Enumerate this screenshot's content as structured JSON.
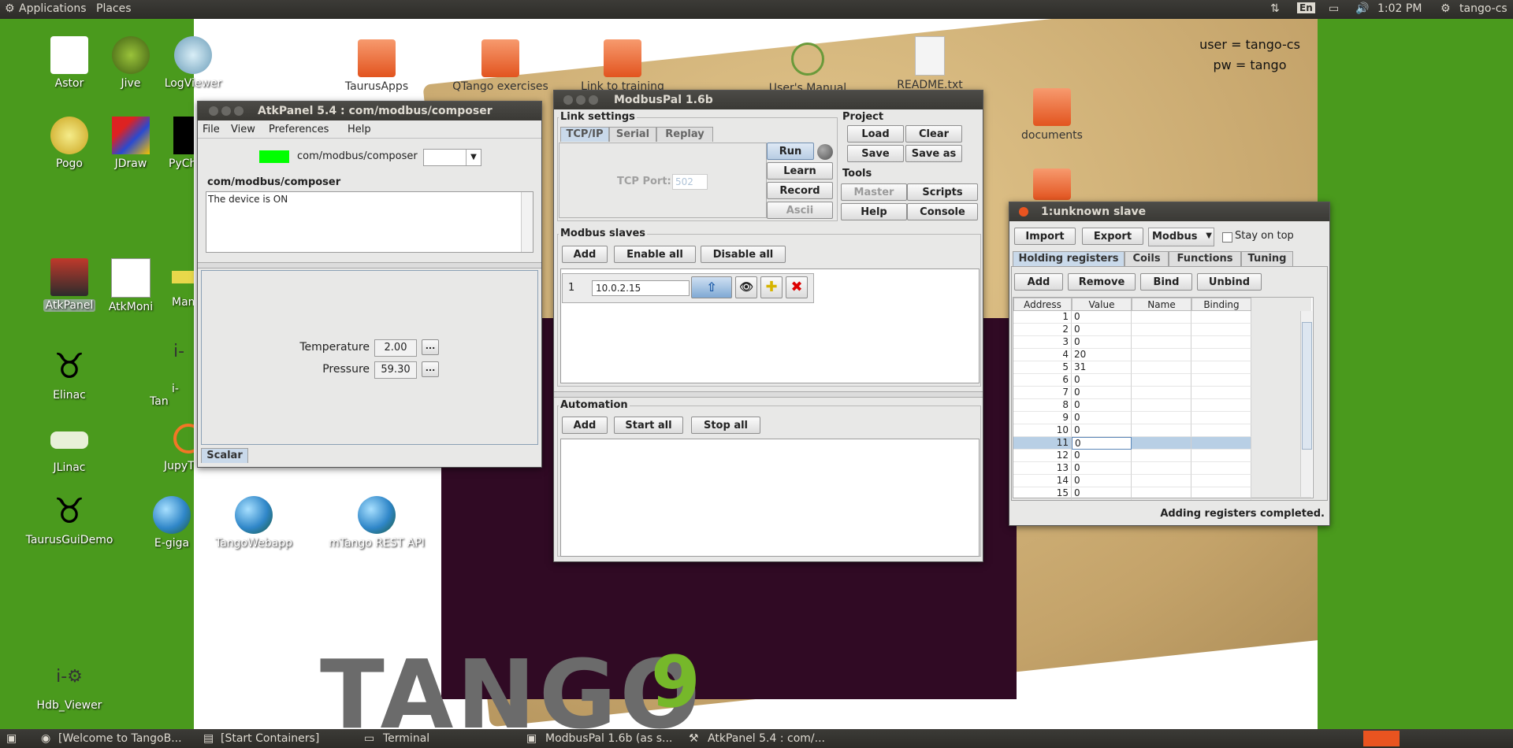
{
  "top_panel": {
    "applications": "Applications",
    "places": "Places",
    "lang": "En",
    "time": "1:02 PM",
    "user": "tango-cs"
  },
  "notes": {
    "user_line": "user = tango-cs",
    "pw_line": "pw = tango"
  },
  "desktop_icons": [
    {
      "label": "Astor"
    },
    {
      "label": "Jive"
    },
    {
      "label": "LogViewer"
    },
    {
      "label": "Pogo"
    },
    {
      "label": "JDraw"
    },
    {
      "label": "PyCh"
    },
    {
      "label": "AtkPanel"
    },
    {
      "label": "AtkMoni"
    },
    {
      "label": "Mam"
    },
    {
      "label": "Elinac"
    },
    {
      "label": "i-Tan"
    },
    {
      "label": "JLinac"
    },
    {
      "label": "JupyT"
    },
    {
      "label": "TaurusGuiDemo"
    },
    {
      "label": "E-giga"
    },
    {
      "label": "TangoWebapp"
    },
    {
      "label": "mTango REST API"
    },
    {
      "label": "Hdb_Viewer"
    },
    {
      "label": "TaurusApps"
    },
    {
      "label": "QTango exercises"
    },
    {
      "label": "Link to training"
    },
    {
      "label": "User's Manual"
    },
    {
      "label": "README.txt"
    },
    {
      "label": "documents"
    }
  ],
  "wallpaper": {
    "logo_text": "TANGO",
    "logo_suffix": "9"
  },
  "atkpanel": {
    "title": "AtkPanel  5.4  : com/modbus/composer",
    "menu": [
      "File",
      "View",
      "Preferences",
      "Help"
    ],
    "device_name": "com/modbus/composer",
    "status_group": "com/modbus/composer",
    "status_text": "The device is ON",
    "state_color": "#00ff00",
    "attrs": [
      {
        "label": "Temperature",
        "value": "2.00",
        "more": "..."
      },
      {
        "label": "Pressure",
        "value": "59.30",
        "more": "..."
      }
    ],
    "tab": "Scalar"
  },
  "modbuspal": {
    "title": "ModbusPal 1.6b",
    "link_settings": "Link settings",
    "link_tabs": [
      "TCP/IP",
      "Serial",
      "Replay"
    ],
    "tcp_port_label": "TCP Port:",
    "tcp_port_value": "502",
    "link_buttons": [
      "Run",
      "Learn",
      "Record",
      "Ascii"
    ],
    "project_label": "Project",
    "project_buttons": [
      "Load",
      "Clear",
      "Save",
      "Save as"
    ],
    "tools_label": "Tools",
    "tools_buttons": [
      "Master",
      "Scripts",
      "Help",
      "Console"
    ],
    "slaves_label": "Modbus slaves",
    "slaves_buttons": [
      "Add",
      "Enable all",
      "Disable all"
    ],
    "slave": {
      "id": "1",
      "address": "10.0.2.15"
    },
    "automation_label": "Automation",
    "automation_buttons": [
      "Add",
      "Start all",
      "Stop all"
    ]
  },
  "slave_window": {
    "title": "1:unknown slave",
    "buttons": [
      "Import",
      "Export"
    ],
    "mode": "Modbus",
    "stay_on_top": "Stay on top",
    "tabs": [
      "Holding registers",
      "Coils",
      "Functions",
      "Tuning"
    ],
    "reg_buttons": [
      "Add",
      "Remove",
      "Bind",
      "Unbind"
    ],
    "columns": [
      "Address",
      "Value",
      "Name",
      "Binding"
    ],
    "rows": [
      {
        "address": "1",
        "value": "0"
      },
      {
        "address": "2",
        "value": "0"
      },
      {
        "address": "3",
        "value": "0"
      },
      {
        "address": "4",
        "value": "20"
      },
      {
        "address": "5",
        "value": "31"
      },
      {
        "address": "6",
        "value": "0"
      },
      {
        "address": "7",
        "value": "0"
      },
      {
        "address": "8",
        "value": "0"
      },
      {
        "address": "9",
        "value": "0"
      },
      {
        "address": "10",
        "value": "0"
      },
      {
        "address": "11",
        "value": "0"
      },
      {
        "address": "12",
        "value": "0"
      },
      {
        "address": "13",
        "value": "0"
      },
      {
        "address": "14",
        "value": "0"
      },
      {
        "address": "15",
        "value": "0"
      }
    ],
    "selected_row": 10,
    "status": "Adding registers completed."
  },
  "taskbar": {
    "items": [
      "[Welcome to TangoB...",
      "[Start Containers]",
      "Terminal",
      "ModbusPal 1.6b (as s...",
      "AtkPanel  5.4  : com/..."
    ]
  },
  "colors": {
    "desktop": "#4a9a1d",
    "accent": "#e95420",
    "selection": "#b8cfe5"
  }
}
